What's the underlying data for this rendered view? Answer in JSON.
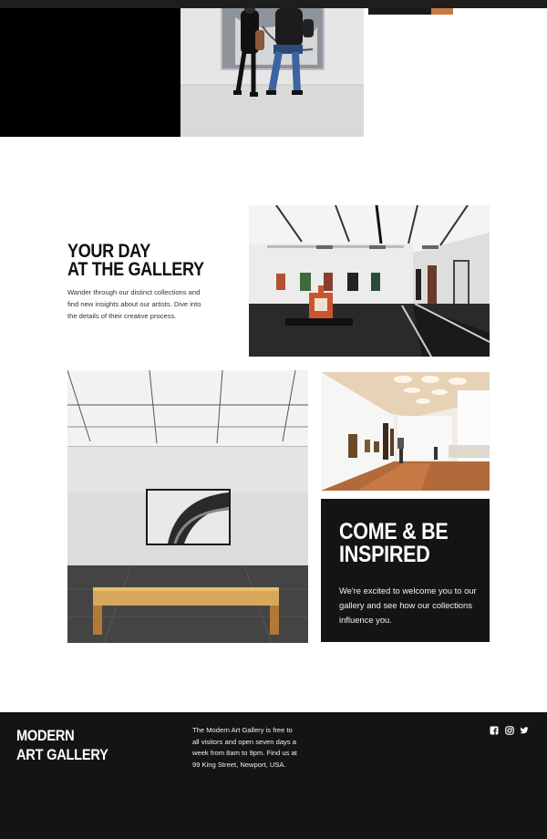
{
  "visit": {
    "heading_line1": "YOUR DAY",
    "heading_line2": "AT THE GALLERY",
    "body": "Wander through our distinct collections and find new insights about our artists. Dive into the details of their creative process."
  },
  "inspire": {
    "heading_line1": "COME & BE",
    "heading_line2": "INSPIRED",
    "body": "We're excited to welcome you to our gallery and see how our collections influence you."
  },
  "footer": {
    "logo_line1": "MODERN",
    "logo_line2": "ART GALLERY",
    "info": "The Modern Art Gallery is free to all visitors and open seven days a week from 8am to 9pm. Find us at 99 King Street, Newport, USA.",
    "social_icons": [
      "facebook-icon",
      "instagram-icon",
      "twitter-icon"
    ]
  },
  "colors": {
    "footer_bg": "#141414",
    "card_bg": "#141414",
    "accent": "#c97a45"
  }
}
